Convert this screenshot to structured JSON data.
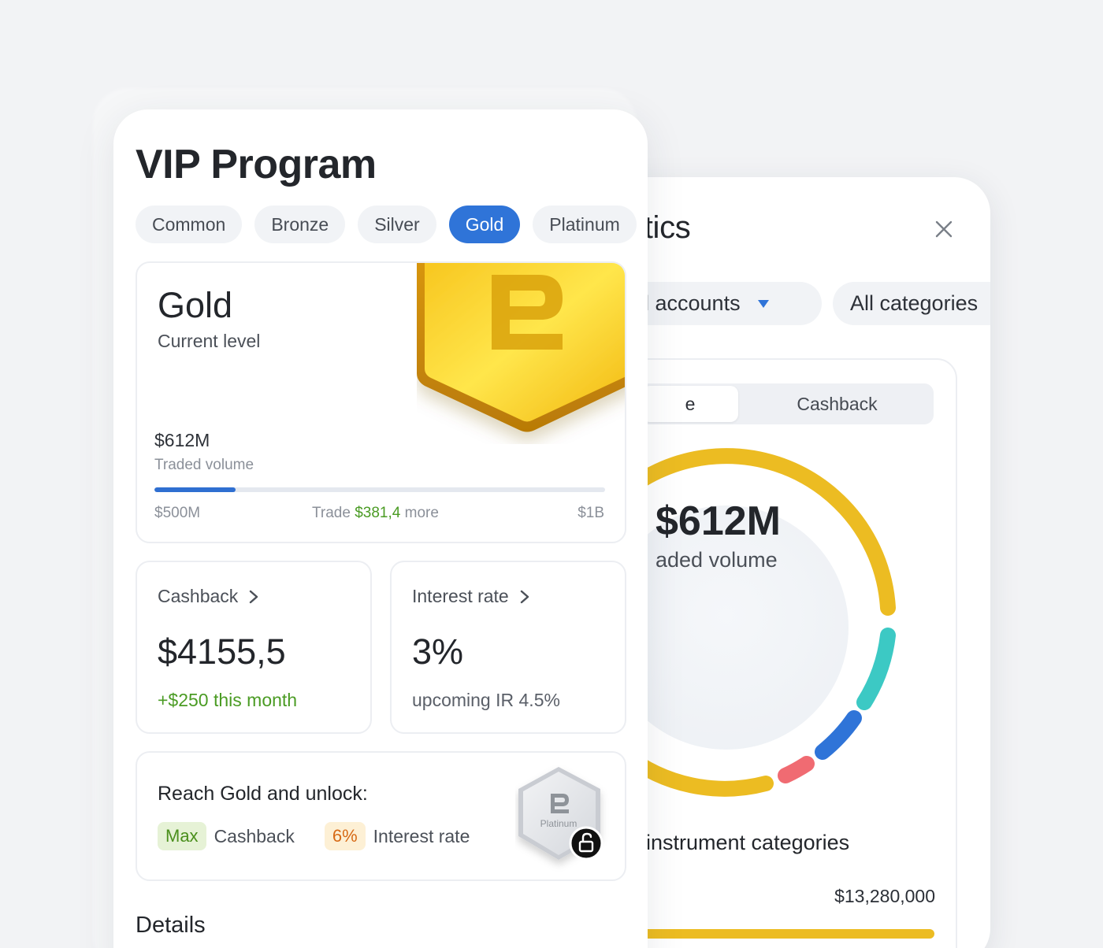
{
  "analytics": {
    "title": "ytics",
    "filters": {
      "accounts": "ll accounts",
      "categories": "All categories"
    },
    "segment": {
      "left": "e",
      "right": "Cashback"
    },
    "donut": {
      "value": "$612M",
      "label": "aded volume"
    },
    "categories_title": "instrument categories",
    "categories_amount": "$13,280,000"
  },
  "vip": {
    "title": "VIP Program",
    "tabs": [
      "Common",
      "Bronze",
      "Silver",
      "Gold",
      "Platinum"
    ],
    "active_tab": "Gold",
    "level": {
      "name": "Gold",
      "subtitle": "Current level",
      "volume_value": "$612M",
      "volume_label": "Traded volume",
      "progress_fraction": 0.18,
      "range_start": "$500M",
      "trade_prefix": "Trade ",
      "trade_amount": "$381,4",
      "trade_suffix": " more",
      "range_end": "$1B"
    },
    "cashback": {
      "label": "Cashback",
      "value": "$4155,5",
      "note": "+$250 this month"
    },
    "interest": {
      "label": "Interest rate",
      "value": "3%",
      "note": "upcoming IR 4.5%"
    },
    "unlock": {
      "title": "Reach Gold and unlock:",
      "chip1": "Max",
      "text1": "Cashback",
      "chip2": "6%",
      "text2": "Interest rate",
      "badge_label": "Platinum"
    },
    "details": "Details"
  },
  "colors": {
    "accent": "#2f74d8",
    "gold": "#ecbc22",
    "teal": "#3cc9c4",
    "blue": "#2f74d8",
    "red": "#f06b72",
    "green": "#4a9b23"
  }
}
